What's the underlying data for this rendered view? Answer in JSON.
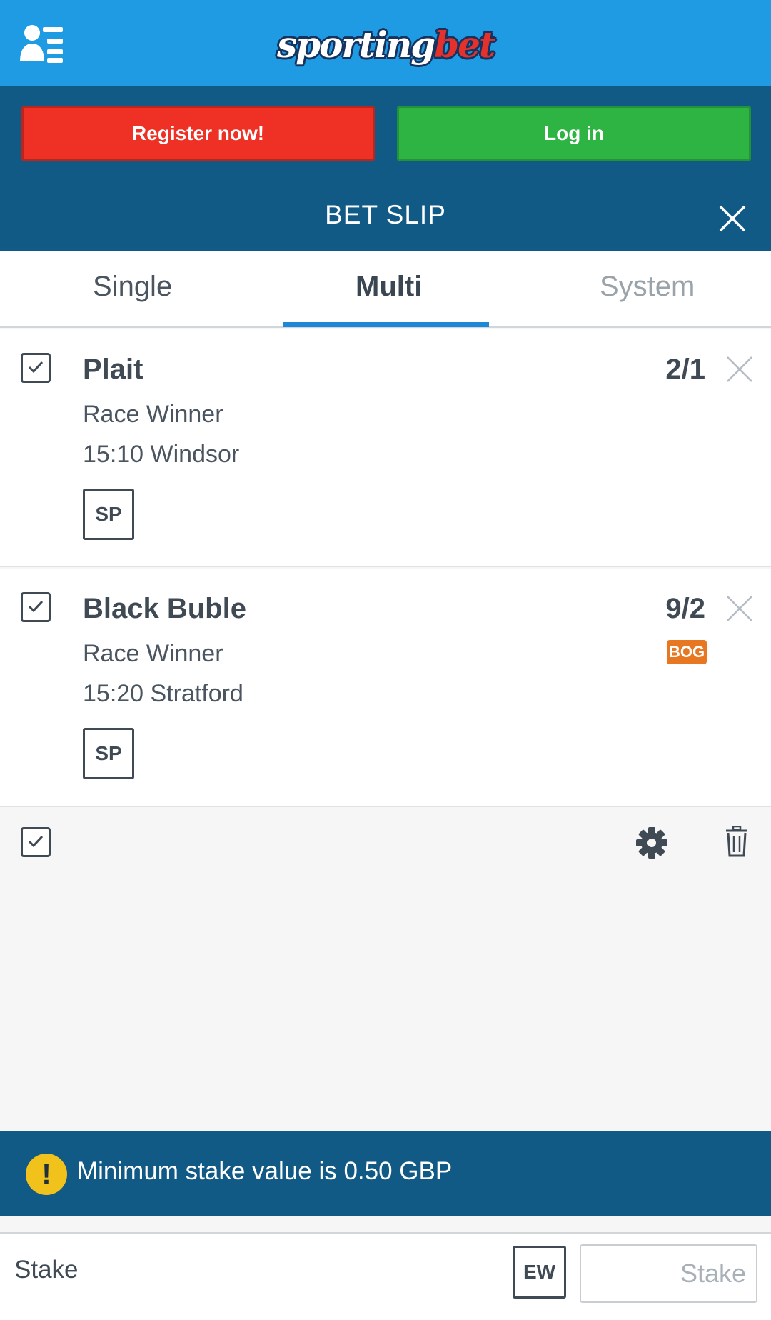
{
  "header": {
    "logo_main": "sporting",
    "logo_accent": "bet",
    "menu_icon": "user-menu-icon"
  },
  "auth": {
    "register_label": "Register now!",
    "login_label": "Log in",
    "colors": {
      "register": "#ee3124",
      "login": "#2db442"
    }
  },
  "betslip": {
    "title": "BET SLIP",
    "close_icon": "close-icon"
  },
  "tabs": [
    {
      "label": "Single",
      "active": false
    },
    {
      "label": "Multi",
      "active": true
    },
    {
      "label": "System",
      "active": false
    }
  ],
  "bets": [
    {
      "selection": "Plait",
      "market": "Race Winner",
      "event": "15:10 Windsor",
      "price_type": "SP",
      "odds": "2/1",
      "checked": true
    },
    {
      "selection": "Black Buble",
      "market": "Race Winner",
      "event": "15:20 Stratford",
      "price_type": "SP",
      "odds": "9/2",
      "badge": "BOG",
      "checked": true
    }
  ],
  "controls": {
    "select_all_checked": true,
    "settings_icon": "gear-icon",
    "delete_icon": "trash-icon"
  },
  "warning": {
    "icon": "!",
    "text": "Minimum stake value is 0.50 GBP"
  },
  "stake": {
    "label": "Stake",
    "ew_label": "EW",
    "input_placeholder": "Stake",
    "input_value": ""
  }
}
